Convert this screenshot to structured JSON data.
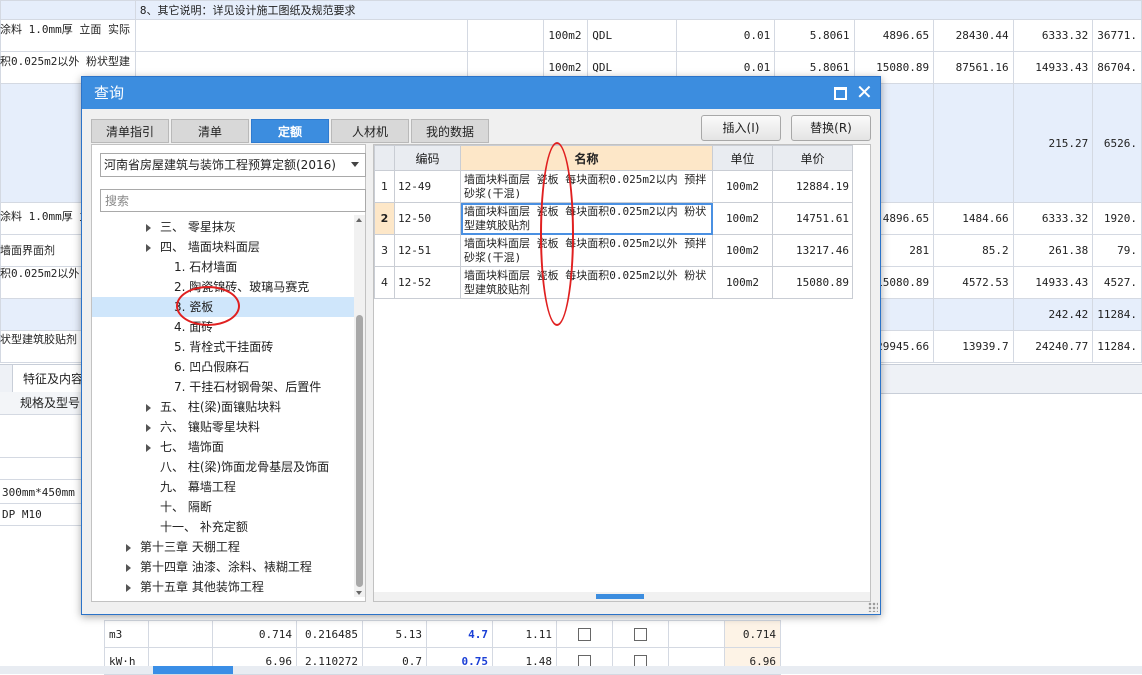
{
  "background": {
    "top_note": "8、其它说明：详见设计施工图纸及规范要求",
    "rows": [
      {
        "desc": "涂料 1.0mm厚 立面  实际",
        "unit": "100m2",
        "code": "QDL",
        "qty": "0.01",
        "c1": "5.8061",
        "c2": "4896.65",
        "c3": "28430.44",
        "c4": "6333.32",
        "c5": "36771."
      },
      {
        "desc": "积0.025m2以外 粉状型建",
        "unit": "100m2",
        "code": "QDL",
        "qty": "0.01",
        "c1": "5.8061",
        "c2": "15080.89",
        "c3": "87561.16",
        "c4": "14933.43",
        "c5": "86704."
      }
    ],
    "blue_row_values": [
      "215.27",
      "6526."
    ],
    "mid_rows": [
      {
        "desc": "涂料 1.0mm厚 立",
        "c2": "4896.65",
        "c3": "1484.66",
        "c4": "6333.32",
        "c5": "1920."
      },
      {
        "desc": "墙面界面剂",
        "c2": "281",
        "c3": "85.2",
        "c4": "261.38",
        "c5": "79."
      },
      {
        "desc": "积0.025m2以外",
        "c2": "15080.89",
        "c3": "4572.53",
        "c4": "14933.43",
        "c5": "4527."
      }
    ],
    "blue_row2_values": [
      "242.42",
      "11284."
    ],
    "last_row": {
      "desc": "状型建筑胶贴剂",
      "c2": "29945.66",
      "c3": "13939.7",
      "c4": "24240.77",
      "c5": "11284."
    },
    "lower_tab": "特征及内容",
    "lower_header": "规格及型号",
    "lower_rows": [
      "300mm*450mm",
      "DP M10"
    ],
    "bottom_rows": [
      {
        "unit": "m3",
        "a": "0.714",
        "b": "0.216485",
        "c": "5.13",
        "d": "4.7",
        "e": "1.11",
        "f": "0.714"
      },
      {
        "unit": "kW·h",
        "a": "6.96",
        "b": "2.110272",
        "c": "0.7",
        "d": "0.75",
        "e": "1.48",
        "f": "6.96"
      }
    ]
  },
  "dialog": {
    "title": "查询",
    "tabs": [
      "清单指引",
      "清单",
      "定额",
      "人材机",
      "我的数据"
    ],
    "active_tab": "定额",
    "insert_label": "插入(I)",
    "replace_label": "替换(R)",
    "select_value": "河南省房屋建筑与装饰工程预算定额(2016)",
    "search_placeholder": "搜索",
    "tree": [
      {
        "label": "三、 零星抹灰",
        "level": 2,
        "arrow": true
      },
      {
        "label": "四、 墙面块料面层",
        "level": 2,
        "arrow": true,
        "open": true
      },
      {
        "label": "1. 石材墙面",
        "level": 3
      },
      {
        "label": "2. 陶瓷锦砖、玻璃马赛克",
        "level": 3
      },
      {
        "label": "3. 瓷板",
        "level": 3,
        "selected": true
      },
      {
        "label": "4. 面砖",
        "level": 3
      },
      {
        "label": "5. 背栓式干挂面砖",
        "level": 3
      },
      {
        "label": "6. 凹凸假麻石",
        "level": 3
      },
      {
        "label": "7. 干挂石材钢骨架、后置件",
        "level": 3
      },
      {
        "label": "五、 柱(梁)面镶贴块料",
        "level": 2,
        "arrow": true
      },
      {
        "label": "六、 镶贴零星块料",
        "level": 2,
        "arrow": true
      },
      {
        "label": "七、 墙饰面",
        "level": 2,
        "arrow": true
      },
      {
        "label": "八、 柱(梁)饰面龙骨基层及饰面",
        "level": 2
      },
      {
        "label": "九、 幕墙工程",
        "level": 2
      },
      {
        "label": "十、 隔断",
        "level": 2
      },
      {
        "label": "十一、 补充定额",
        "level": 2
      },
      {
        "label": "第十三章 天棚工程",
        "level": 1,
        "arrow": true
      },
      {
        "label": "第十四章 油漆、涂料、裱糊工程",
        "level": 1,
        "arrow": true
      },
      {
        "label": "第十五章 其他装饰工程",
        "level": 1,
        "arrow": true
      }
    ],
    "grid_headers": {
      "code": "编码",
      "name": "名称",
      "unit": "单位",
      "price": "单价"
    },
    "grid_rows": [
      {
        "idx": "1",
        "code": "12-49",
        "name": "墙面块料面层 瓷板 每块面积0.025m2以内 预拌砂浆(干混)",
        "unit": "100m2",
        "price": "12884.19"
      },
      {
        "idx": "2",
        "code": "12-50",
        "name": "墙面块料面层 瓷板 每块面积0.025m2以内 粉状型建筑胶贴剂",
        "unit": "100m2",
        "price": "14751.61"
      },
      {
        "idx": "3",
        "code": "12-51",
        "name": "墙面块料面层 瓷板 每块面积0.025m2以外 预拌砂浆(干混)",
        "unit": "100m2",
        "price": "13217.46"
      },
      {
        "idx": "4",
        "code": "12-52",
        "name": "墙面块料面层 瓷板 每块面积0.025m2以外 粉状型建筑胶贴剂",
        "unit": "100m2",
        "price": "15080.89"
      }
    ],
    "current_row": "2"
  }
}
